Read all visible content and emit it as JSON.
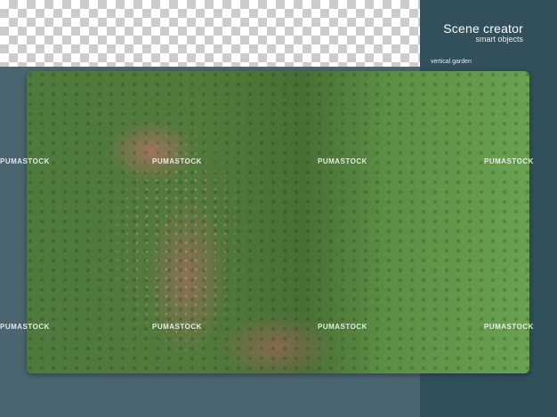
{
  "header": {
    "title": "Scene creator",
    "subtitle": "smart objects"
  },
  "caption": "vertical garden",
  "watermark": "PUMASTOCK",
  "colors": {
    "background": "#4a6470",
    "panel": "#31505c",
    "checker_light": "#ffffff",
    "checker_dark": "#cccccc"
  }
}
